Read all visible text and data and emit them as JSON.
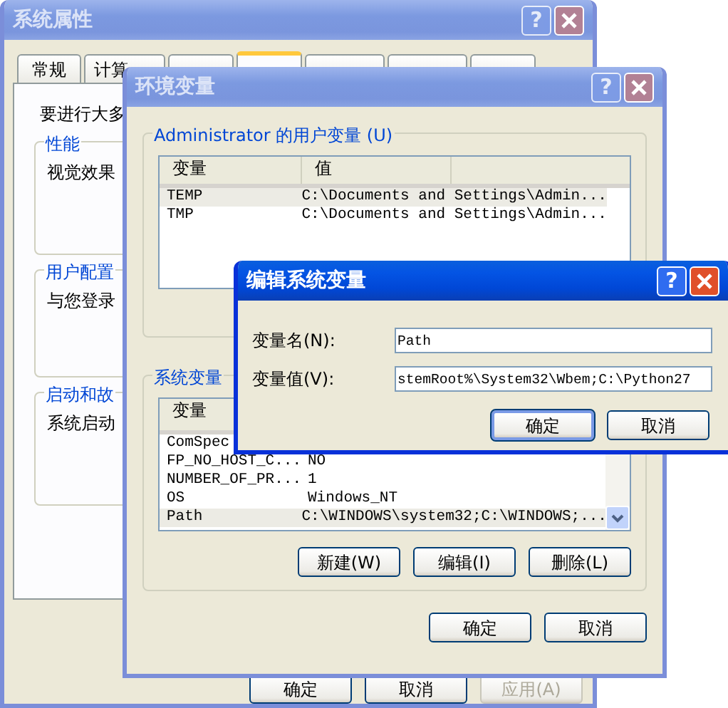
{
  "system_properties": {
    "title": "系统属性",
    "active": false,
    "help_button": "?",
    "tabs": [
      {
        "label": "常规",
        "selected": false
      },
      {
        "label": "计算",
        "selected": false
      },
      {
        "selected": false
      },
      {
        "selected": true
      },
      {
        "selected": false
      },
      {
        "selected": false
      },
      {
        "selected": false
      }
    ],
    "intro": "要进行大多",
    "groups": [
      {
        "title": "性能",
        "text": "视觉效果"
      },
      {
        "title": "用户配置",
        "text": "与您登录"
      },
      {
        "title": "启动和故",
        "text": "系统启动"
      }
    ],
    "buttons": [
      {
        "label": "确定",
        "disabled": false
      },
      {
        "label": "取消",
        "disabled": false
      },
      {
        "label": "应用(A)",
        "disabled": true
      }
    ]
  },
  "environment_variables": {
    "title": "环境变量",
    "active": false,
    "help_button": "?",
    "user_group": {
      "title": "Administrator 的用户变量 (U)",
      "columns": [
        "变量",
        "值"
      ],
      "rows": [
        {
          "name": "TEMP",
          "value": "C:\\Documents and Settings\\Admin...",
          "selected": true
        },
        {
          "name": "TMP",
          "value": "C:\\Documents and Settings\\Admin...",
          "selected": false
        }
      ]
    },
    "system_group": {
      "title": "系统变量",
      "columns": [
        "变量"
      ],
      "rows": [
        {
          "name": "ComSpec",
          "selected": false
        },
        {
          "name": "FP_NO_HOST_C...",
          "value": "NO",
          "selected": false
        },
        {
          "name": "NUMBER_OF_PR...",
          "value": "1",
          "selected": false
        },
        {
          "name": "OS",
          "value": "Windows_NT",
          "selected": false
        },
        {
          "name": "Path",
          "value": "C:\\WINDOWS\\system32;C:\\WINDOWS;...",
          "selected": true
        }
      ],
      "buttons": [
        "新建(W)",
        "编辑(I)",
        "删除(L)"
      ]
    },
    "buttons": [
      "确定",
      "取消"
    ]
  },
  "edit_dialog": {
    "title": "编辑系统变量",
    "active": true,
    "help_button": "?",
    "fields": [
      {
        "label": "变量名(N):",
        "value": "Path"
      },
      {
        "label": "变量值(V):",
        "value": "stemRoot%\\System32\\Wbem;C:\\Python27"
      }
    ],
    "buttons": [
      {
        "label": "确定",
        "default": true
      },
      {
        "label": "取消",
        "default": false
      }
    ]
  }
}
